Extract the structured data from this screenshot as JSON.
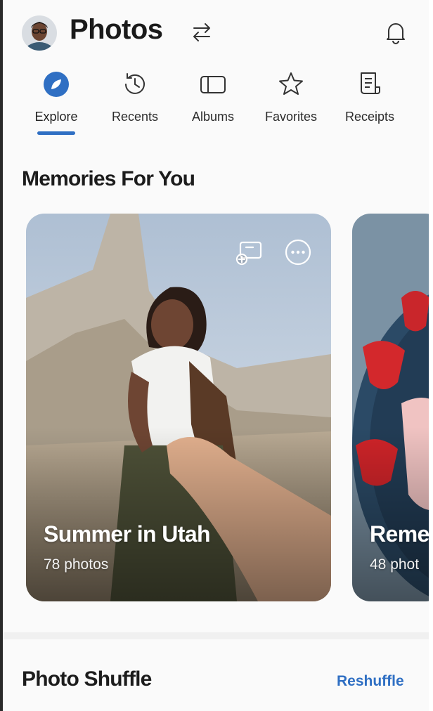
{
  "header": {
    "title": "Photos",
    "icons": {
      "switch": "switch-arrows-icon",
      "notifications": "bell-icon"
    }
  },
  "tabs": [
    {
      "label": "Explore",
      "icon": "compass-icon",
      "active": true
    },
    {
      "label": "Recents",
      "icon": "history-clock-icon",
      "active": false
    },
    {
      "label": "Albums",
      "icon": "album-icon",
      "active": false
    },
    {
      "label": "Favorites",
      "icon": "star-icon",
      "active": false
    },
    {
      "label": "Receipts",
      "icon": "receipt-icon",
      "active": false
    }
  ],
  "memories": {
    "title": "Memories For You",
    "cards": [
      {
        "title": "Summer in Utah",
        "count": "78 photos"
      },
      {
        "title": "Reme",
        "count": "48 phot"
      }
    ]
  },
  "shuffle": {
    "title": "Photo Shuffle",
    "action": "Reshuffle"
  },
  "colors": {
    "accent": "#2f6fc3",
    "background": "#fafafa"
  }
}
